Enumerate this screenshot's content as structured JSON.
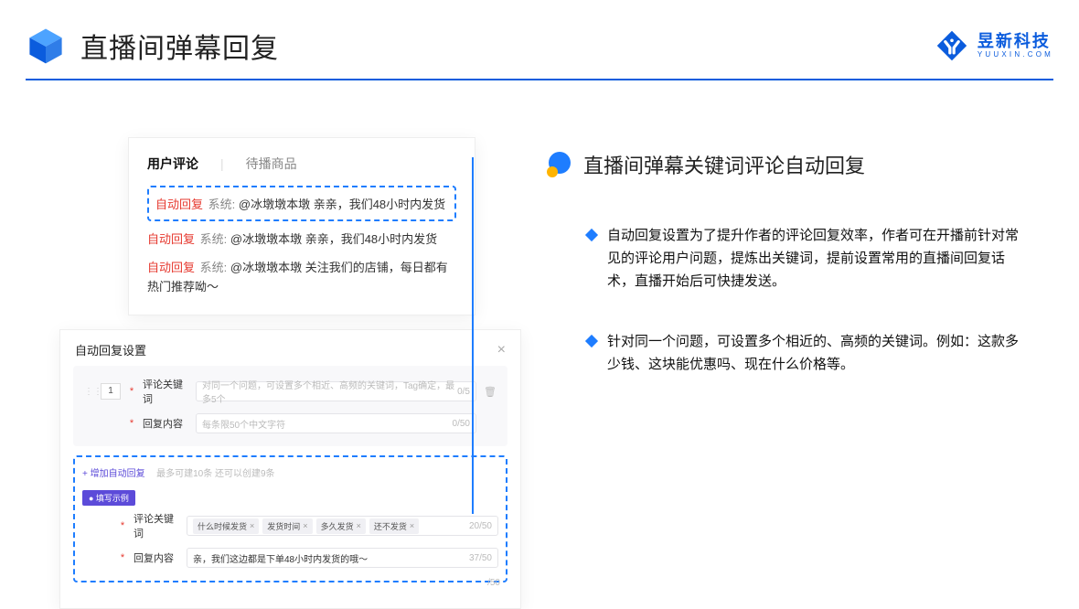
{
  "header": {
    "page_title": "直播间弹幕回复",
    "brand_cn": "昱新科技",
    "brand_en": "YUUXIN.COM"
  },
  "comments_panel": {
    "tab_active": "用户评论",
    "tab_inactive": "待播商品",
    "highlighted": "自动回复 系统: @冰墩墩本墩 亲亲，我们48小时内发货",
    "reply2": "自动回复 系统: @冰墩墩本墩 亲亲，我们48小时内发货",
    "reply3": "自动回复 系统: @冰墩墩本墩 关注我们的店铺，每日都有热门推荐呦～",
    "tag_auto": "自动回复",
    "tag_sys": "系统:",
    "h_user": "@冰墩墩本墩",
    "h_msg1": " 亲亲，我们48小时内发货",
    "h_msg3": " 关注我们的店铺，每日都有热门推荐呦～"
  },
  "settings_panel": {
    "title": "自动回复设置",
    "row_num": "1",
    "kw_label": "评论关键词",
    "kw_placeholder": "对同一个问题，可设置多个相近、高频的关键词，Tag确定，最多5个",
    "kw_counter": "0/5",
    "content_label": "回复内容",
    "content_placeholder": "每条限50个中文字符",
    "content_counter": "0/50",
    "add_link": "+ 增加自动回复",
    "add_hint": "最多可建10条 还可以创建9条",
    "example_badge": "● 填写示例",
    "example_tags": [
      "什么时候发货",
      "发货时间",
      "多久发货",
      "还不发货"
    ],
    "example_kw_counter": "20/50",
    "example_content": "亲，我们这边都是下单48小时内发货的哦～",
    "example_content_counter": "37/50",
    "outside_counter": "/50"
  },
  "right": {
    "title": "直播间弹幕关键词评论自动回复",
    "bullet1": "自动回复设置为了提升作者的评论回复效率，作者可在开播前针对常见的评论用户问题，提炼出关键词，提前设置常用的直播间回复话术，直播开始后可快捷发送。",
    "bullet2": "针对同一个问题，可设置多个相近的、高频的关键词。例如：这款多少钱、这块能优惠吗、现在什么价格等。"
  }
}
